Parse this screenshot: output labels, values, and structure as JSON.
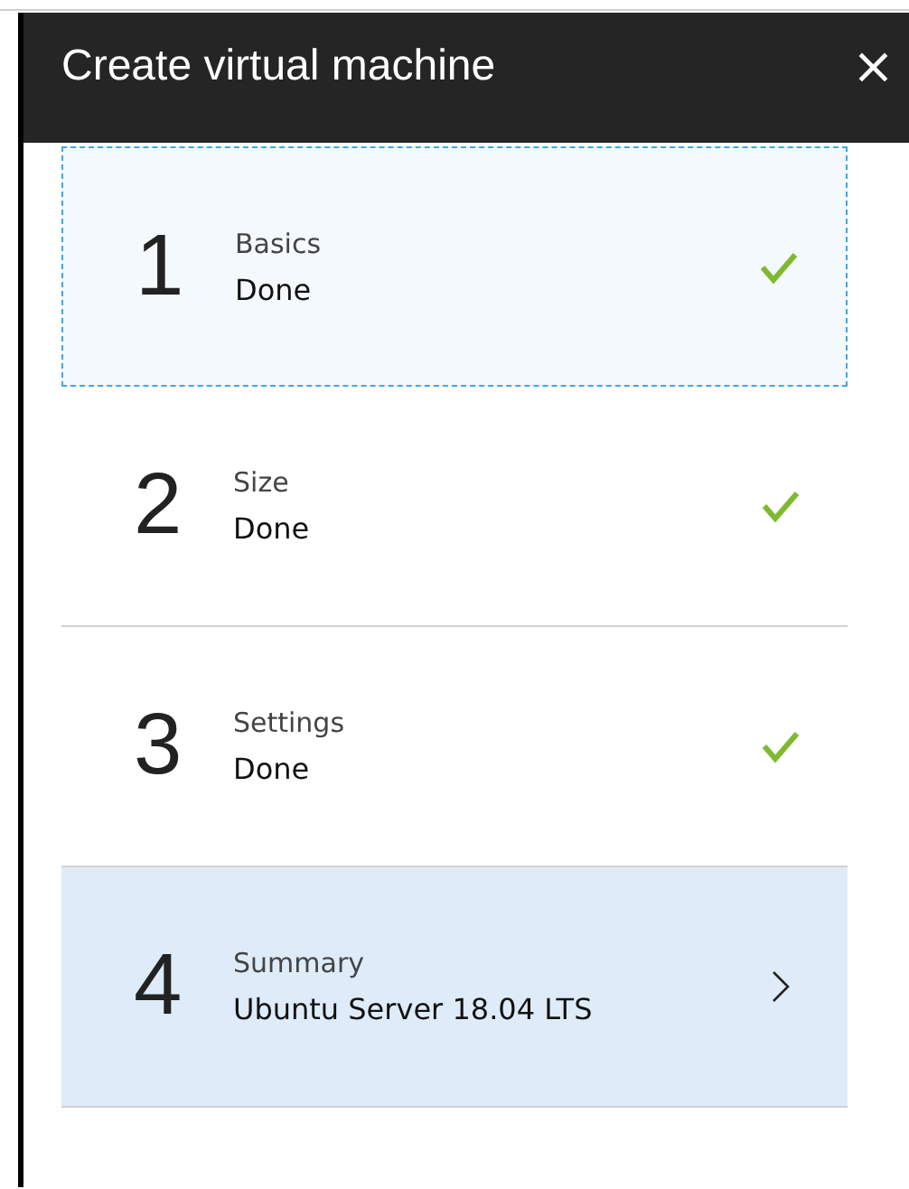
{
  "window": {
    "title": "Create virtual machine",
    "close": "×"
  },
  "steps": [
    {
      "number": "1",
      "label": "Basics",
      "value": "Done",
      "kind": "done",
      "focused": true,
      "selected": false
    },
    {
      "number": "2",
      "label": "Size",
      "value": "Done",
      "kind": "done",
      "focused": false,
      "selected": false
    },
    {
      "number": "3",
      "label": "Settings",
      "value": "Done",
      "kind": "done",
      "focused": false,
      "selected": false
    },
    {
      "number": "4",
      "label": "Summary",
      "value": "Ubuntu Server 18.04 LTS",
      "kind": "next",
      "focused": false,
      "selected": true
    }
  ]
}
